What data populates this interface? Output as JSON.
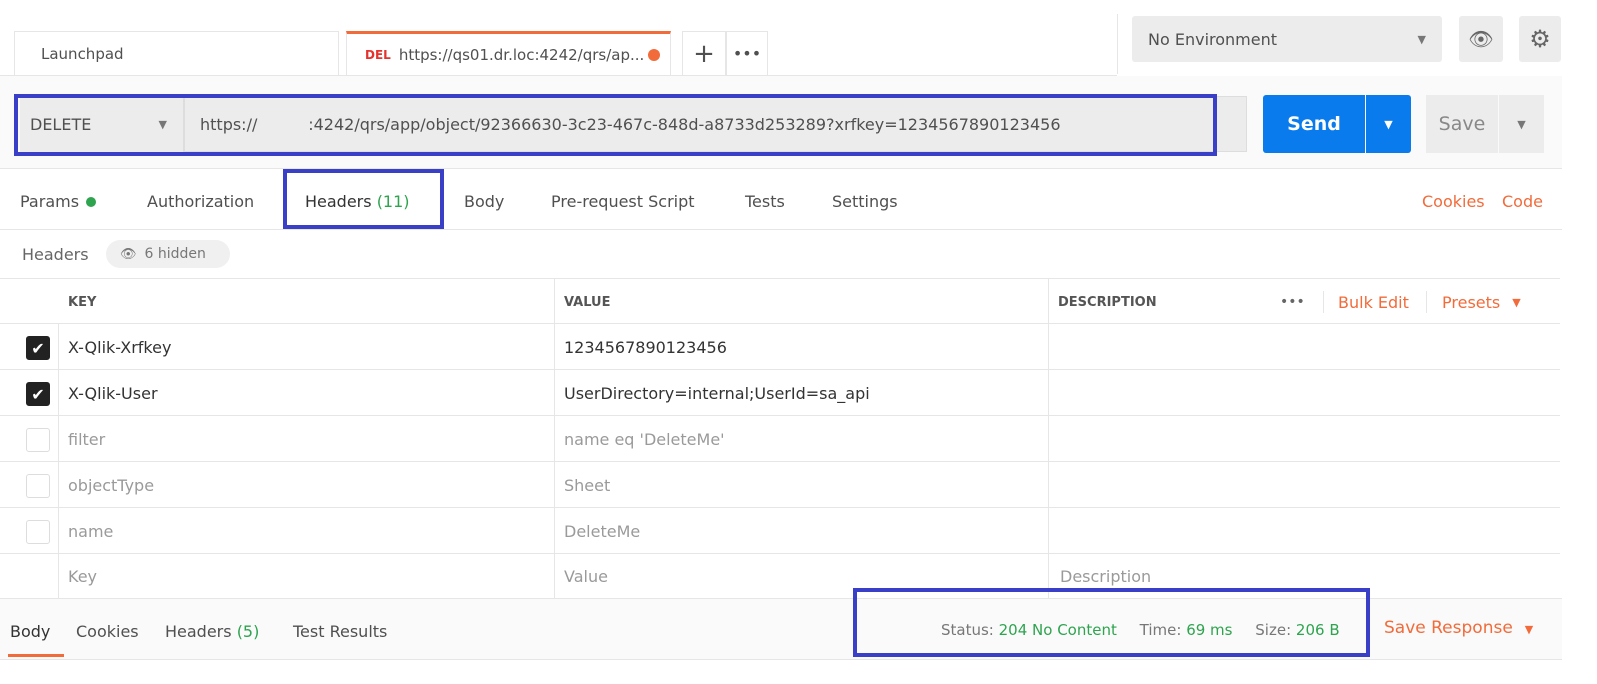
{
  "tabs": [
    {
      "label": "Launchpad"
    },
    {
      "method": "DEL",
      "label": "https://qs01.dr.loc:4242/qrs/ap..."
    }
  ],
  "environment": {
    "selected": "No Environment"
  },
  "request": {
    "method": "DELETE",
    "url": "https://          :4242/qrs/app/object/92366630-3c23-467c-848d-a8733d253289?xrfkey=1234567890123456",
    "send_label": "Send",
    "save_label": "Save"
  },
  "req_tabs": {
    "params": "Params",
    "authorization": "Authorization",
    "headers": "Headers",
    "headers_count": "(11)",
    "body": "Body",
    "prerequest": "Pre-request Script",
    "tests": "Tests",
    "settings": "Settings",
    "cookies": "Cookies",
    "code": "Code"
  },
  "headers_bar": {
    "label": "Headers",
    "hidden": "6 hidden"
  },
  "table": {
    "columns": {
      "key": "KEY",
      "value": "VALUE",
      "description": "DESCRIPTION"
    },
    "bulk_edit": "Bulk Edit",
    "presets": "Presets",
    "rows": [
      {
        "checked": true,
        "key": "X-Qlik-Xrfkey",
        "value": "1234567890123456"
      },
      {
        "checked": true,
        "key": "X-Qlik-User",
        "value": "UserDirectory=internal;UserId=sa_api"
      },
      {
        "checked": false,
        "key": "filter",
        "value": "name eq 'DeleteMe'"
      },
      {
        "checked": false,
        "key": "objectType",
        "value": "Sheet"
      },
      {
        "checked": false,
        "key": "name",
        "value": "DeleteMe"
      }
    ],
    "placeholder": {
      "key": "Key",
      "value": "Value",
      "description": "Description"
    }
  },
  "response": {
    "tabs": {
      "body": "Body",
      "cookies": "Cookies",
      "headers": "Headers",
      "headers_count": "(5)",
      "test_results": "Test Results"
    },
    "status_label": "Status:",
    "status": "204 No Content",
    "time_label": "Time:",
    "time": "69 ms",
    "size_label": "Size:",
    "size": "206 B",
    "save_response": "Save Response"
  }
}
